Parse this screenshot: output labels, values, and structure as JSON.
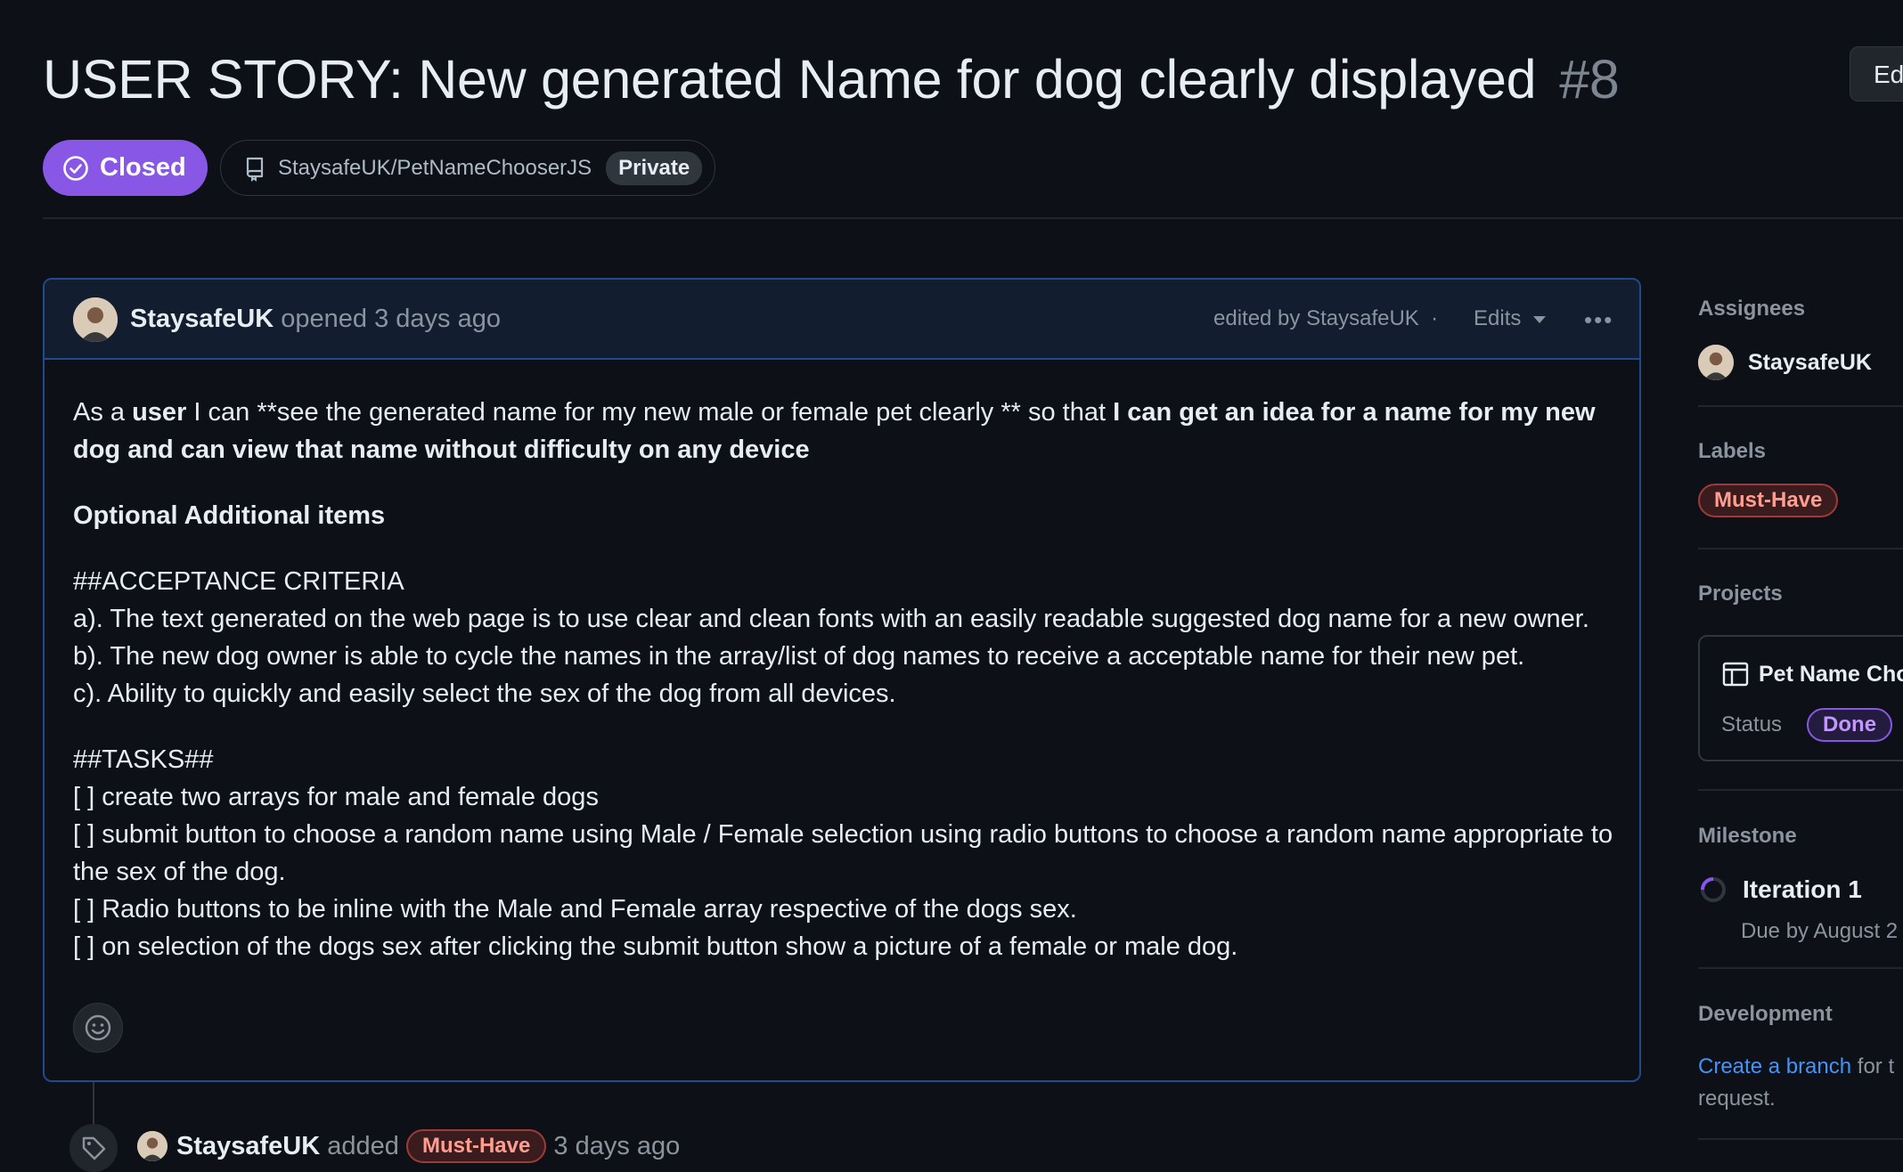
{
  "issue": {
    "title": "USER STORY: New generated Name for dog clearly displayed",
    "number": "#8",
    "edit_label": "Ed",
    "state": "Closed",
    "repo": "StaysafeUK/PetNameChooserJS",
    "visibility": "Private"
  },
  "comment": {
    "author": "StaysafeUK",
    "opened_text": "opened 3 days ago",
    "edited_text": "edited by StaysafeUK",
    "edits_label": "Edits",
    "body": {
      "p1_a": "As a ",
      "p1_b": "user",
      "p1_c": " I can **see the generated name for my new male or female pet clearly ** so that ",
      "p1_d": "I can get an idea for a name for my new dog and can view that name without difficulty on any device",
      "optional_heading": "Optional Additional items",
      "acceptance_heading": "##ACCEPTANCE CRITERIA",
      "criteria": [
        "a). The text generated on the web page is to use clear and clean fonts with an easily readable suggested dog name for a new owner.",
        "b). The new dog owner is able to cycle the names in the array/list of dog names to receive a acceptable name for their new pet.",
        "c). Ability to quickly and easily select the sex of the dog from all devices."
      ],
      "tasks_heading": "##TASKS##",
      "tasks": [
        "[ ] create two arrays for male and female dogs",
        "[ ] submit button to choose a random name using Male / Female selection using radio buttons to choose a random name appropriate to the sex of the dog.",
        "[ ] Radio buttons to be inline with the Male and Female array respective of the dogs sex.",
        "[ ] on selection of the dogs sex after clicking the submit button show a picture of a female or male dog."
      ]
    }
  },
  "timeline_event": {
    "actor": "StaysafeUK",
    "action": "added",
    "label": "Must-Have",
    "time": "3 days ago"
  },
  "sidebar": {
    "assignees_heading": "Assignees",
    "assignee": "StaysafeUK",
    "labels_heading": "Labels",
    "label": "Must-Have",
    "projects_heading": "Projects",
    "project_name": "Pet Name Cho",
    "status_label": "Status",
    "status_value": "Done",
    "milestone_heading": "Milestone",
    "milestone_name": "Iteration 1",
    "milestone_due": "Due by August 2",
    "development_heading": "Development",
    "dev_link": "Create a branch",
    "dev_text_1": " for t",
    "dev_text_2": "request."
  },
  "colors": {
    "background": "#0d1117",
    "closed_purple": "#8957e5",
    "comment_border": "#1f4a8c",
    "label_red": "#ff9e90",
    "link_blue": "#4493f8"
  }
}
